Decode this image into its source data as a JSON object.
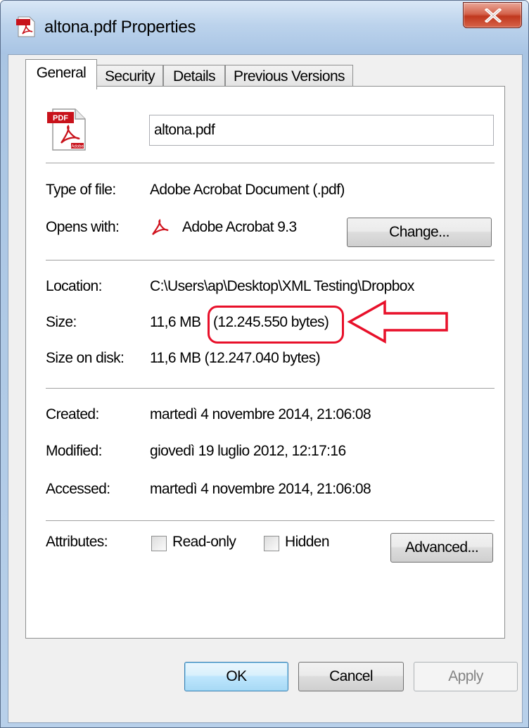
{
  "window": {
    "title": "altona.pdf Properties",
    "icons": {
      "title": "pdf-file-icon",
      "close": "close-icon"
    }
  },
  "tabs": [
    {
      "label": "General",
      "active": true
    },
    {
      "label": "Security",
      "active": false
    },
    {
      "label": "Details",
      "active": false
    },
    {
      "label": "Previous Versions",
      "active": false
    }
  ],
  "general": {
    "filename": "altona.pdf",
    "type_label": "Type of file:",
    "type_value": "Adobe Acrobat Document (.pdf)",
    "opens_label": "Opens with:",
    "opens_value": "Adobe Acrobat 9.3",
    "change_button": "Change...",
    "location_label": "Location:",
    "location_value": "C:\\Users\\ap\\Desktop\\XML Testing\\Dropbox",
    "size_label": "Size:",
    "size_value_mb": "11,6 MB",
    "size_value_bytes": "(12.245.550 bytes)",
    "size_disk_label": "Size on disk:",
    "size_disk_value": "11,6 MB (12.247.040 bytes)",
    "created_label": "Created:",
    "created_value": "martedì 4 novembre 2014, 21:06:08",
    "modified_label": "Modified:",
    "modified_value": "giovedì 19 luglio 2012, 12:17:16",
    "accessed_label": "Accessed:",
    "accessed_value": "martedì 4 novembre 2014, 21:06:08",
    "attributes_label": "Attributes:",
    "readonly_label": "Read-only",
    "readonly_checked": false,
    "hidden_label": "Hidden",
    "hidden_checked": false,
    "advanced_button": "Advanced..."
  },
  "footer": {
    "ok_button": "OK",
    "cancel_button": "Cancel",
    "apply_button": "Apply"
  },
  "annotation": {
    "highlight_color": "#e8102a"
  }
}
